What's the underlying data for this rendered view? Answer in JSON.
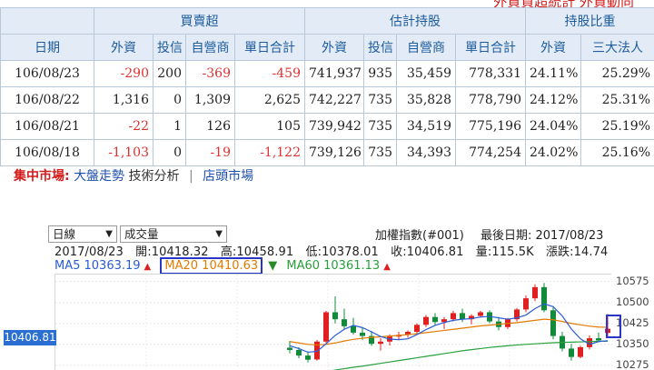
{
  "top_header_red_partial": "外資買超統計   外資動向",
  "table": {
    "group_headers": [
      "買賣超",
      "估計持股",
      "持股比重"
    ],
    "columns": [
      "日期",
      "外資",
      "投信",
      "自營商",
      "單日合計",
      "外資",
      "投信",
      "自營商",
      "單日合計",
      "外資",
      "三大法人"
    ],
    "rows": [
      {
        "date": "106/08/23",
        "f": "-290",
        "t": "200",
        "d": "-369",
        "sum": "-459",
        "hf": "741,937",
        "ht": "935",
        "hd": "35,459",
        "hsum": "778,331",
        "pf": "24.11%",
        "p3": "25.29%"
      },
      {
        "date": "106/08/22",
        "f": "1,316",
        "t": "0",
        "d": "1,309",
        "sum": "2,625",
        "hf": "742,227",
        "ht": "735",
        "hd": "35,828",
        "hsum": "778,790",
        "pf": "24.12%",
        "p3": "25.31%"
      },
      {
        "date": "106/08/21",
        "f": "-22",
        "t": "1",
        "d": "126",
        "sum": "105",
        "hf": "739,942",
        "ht": "735",
        "hd": "34,519",
        "hsum": "775,196",
        "pf": "24.04%",
        "p3": "25.19%"
      },
      {
        "date": "106/08/18",
        "f": "-1,103",
        "t": "0",
        "d": "-19",
        "sum": "-1,122",
        "hf": "739,126",
        "ht": "735",
        "hd": "34,393",
        "hsum": "774,254",
        "pf": "24.02%",
        "p3": "25.16%"
      }
    ]
  },
  "nav": {
    "prefix": "集中市場:",
    "items": [
      "大盤走勢",
      "技術分析",
      "店頭市場"
    ],
    "separator": "|"
  },
  "chart": {
    "period_select": "日線",
    "indicator_select": "成交量",
    "index_name": "加權指數(#001)",
    "last_date_label": "最後日期: 2017/08/23",
    "ohlc": {
      "date": "2017/08/23",
      "open": "開:10418.32",
      "high": "高:10458.91",
      "low": "低:10378.01",
      "close": "收:10406.81",
      "volume": "量:115.5K",
      "change": "漲跌:14.74"
    },
    "ma": {
      "ma5": "MA5 10363.19",
      "ma20": "MA20 10410.63",
      "ma60": "MA60 10361.13"
    },
    "current_price_tag": "10406.81",
    "y_ticks": [
      "10575",
      "10500",
      "10425",
      "10350",
      "10275"
    ],
    "colors": {
      "up": "#e02020",
      "down": "#118a3a",
      "ma5": "#2a5bd7",
      "ma20": "#e27b00",
      "ma60": "#28a03c",
      "highlight": "#2a36c6"
    }
  },
  "chart_data": {
    "type": "candlestick",
    "y_ticks": [
      10575,
      10500,
      10425,
      10350,
      10275
    ],
    "candles": [
      [
        10338,
        10362,
        10318,
        10330
      ],
      [
        10330,
        10340,
        10300,
        10310
      ],
      [
        10310,
        10325,
        10285,
        10295
      ],
      [
        10296,
        10366,
        10292,
        10360
      ],
      [
        10360,
        10470,
        10355,
        10465
      ],
      [
        10465,
        10522,
        10425,
        10440
      ],
      [
        10440,
        10478,
        10402,
        10415
      ],
      [
        10415,
        10445,
        10385,
        10392
      ],
      [
        10392,
        10412,
        10366,
        10380
      ],
      [
        10380,
        10398,
        10345,
        10352
      ],
      [
        10352,
        10372,
        10328,
        10360
      ],
      [
        10360,
        10386,
        10346,
        10378
      ],
      [
        10378,
        10395,
        10365,
        10384
      ],
      [
        10384,
        10400,
        10374,
        10395
      ],
      [
        10395,
        10425,
        10388,
        10420
      ],
      [
        10420,
        10455,
        10412,
        10448
      ],
      [
        10448,
        10462,
        10420,
        10430
      ],
      [
        10430,
        10448,
        10405,
        10440
      ],
      [
        10440,
        10470,
        10432,
        10462
      ],
      [
        10462,
        10478,
        10430,
        10440
      ],
      [
        10440,
        10458,
        10422,
        10452
      ],
      [
        10452,
        10470,
        10446,
        10465
      ],
      [
        10465,
        10472,
        10426,
        10432
      ],
      [
        10432,
        10448,
        10400,
        10412
      ],
      [
        10412,
        10445,
        10405,
        10440
      ],
      [
        10440,
        10480,
        10432,
        10475
      ],
      [
        10475,
        10525,
        10465,
        10515
      ],
      [
        10515,
        10565,
        10505,
        10555
      ],
      [
        10555,
        10570,
        10465,
        10472
      ],
      [
        10472,
        10482,
        10368,
        10380
      ],
      [
        10380,
        10395,
        10325,
        10335
      ],
      [
        10335,
        10352,
        10292,
        10305
      ],
      [
        10305,
        10345,
        10300,
        10340
      ],
      [
        10340,
        10382,
        10332,
        10372
      ],
      [
        10372,
        10392,
        10358,
        10364
      ],
      [
        10391,
        10459,
        10378,
        10406
      ]
    ],
    "ma5": [
      10345,
      10335,
      10322,
      10325,
      10352,
      10382,
      10404,
      10418,
      10410,
      10395,
      10378,
      10369,
      10367,
      10370,
      10385,
      10403,
      10418,
      10428,
      10436,
      10440,
      10442,
      10448,
      10450,
      10445,
      10440,
      10445,
      10455,
      10478,
      10495,
      10485,
      10452,
      10405,
      10370,
      10350,
      10360,
      10363
    ],
    "ma20": [
      10360,
      10355,
      10350,
      10348,
      10350,
      10355,
      10362,
      10368,
      10372,
      10375,
      10377,
      10380,
      10382,
      10385,
      10388,
      10392,
      10396,
      10400,
      10404,
      10408,
      10412,
      10416,
      10419,
      10422,
      10425,
      10428,
      10432,
      10436,
      10440,
      10438,
      10432,
      10425,
      10420,
      10415,
      10412,
      10411
    ],
    "ma60": [
      10235,
      10240,
      10244,
      10248,
      10253,
      10258,
      10263,
      10268,
      10272,
      10277,
      10282,
      10287,
      10292,
      10297,
      10302,
      10307,
      10312,
      10317,
      10322,
      10327,
      10331,
      10335,
      10339,
      10342,
      10345,
      10348,
      10350,
      10352,
      10354,
      10356,
      10357,
      10358,
      10359,
      10360,
      10361,
      10361
    ]
  }
}
